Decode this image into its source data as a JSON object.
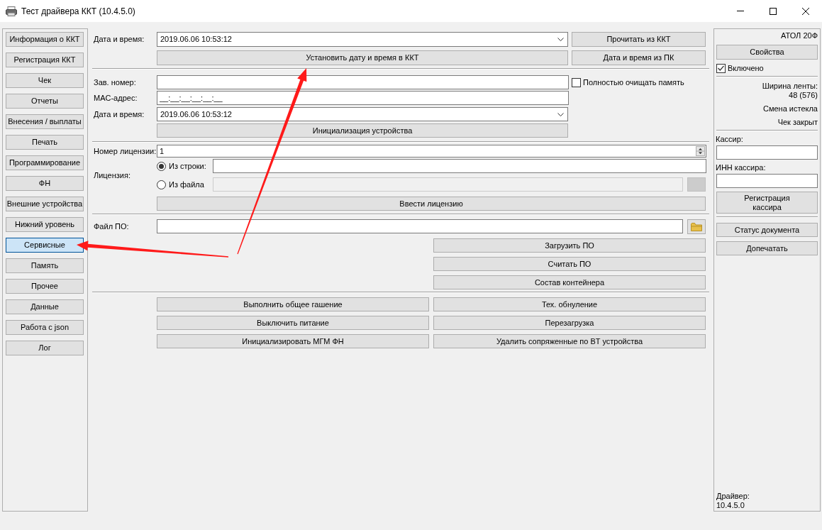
{
  "window": {
    "title": "Тест драйвера ККТ (10.4.5.0)"
  },
  "sidebar": {
    "items": [
      {
        "label": "Информация о ККТ",
        "selected": false
      },
      {
        "label": "Регистрация ККТ",
        "selected": false
      },
      {
        "label": "Чек",
        "selected": false
      },
      {
        "label": "Отчеты",
        "selected": false
      },
      {
        "label": "Внесения / выплаты",
        "selected": false
      },
      {
        "label": "Печать",
        "selected": false
      },
      {
        "label": "Программирование",
        "selected": false
      },
      {
        "label": "ФН",
        "selected": false
      },
      {
        "label": "Внешние устройства",
        "selected": false
      },
      {
        "label": "Нижний уровень",
        "selected": false
      },
      {
        "label": "Сервисные",
        "selected": true
      },
      {
        "label": "Память",
        "selected": false
      },
      {
        "label": "Прочее",
        "selected": false
      },
      {
        "label": "Данные",
        "selected": false
      },
      {
        "label": "Работа с json",
        "selected": false
      },
      {
        "label": "Лог",
        "selected": false
      }
    ]
  },
  "datetime": {
    "label": "Дата и время:",
    "value": "2019.06.06 10:53:12",
    "read_button": "Прочитать из ККТ",
    "set_button": "Установить дату и время в ККТ",
    "from_pc_button": "Дата и время из ПК"
  },
  "init": {
    "serial_label": "Зав. номер:",
    "clear_memory": {
      "label": "Полностью очищать память",
      "checked": false
    },
    "mac_label": "MAC-адрес:",
    "mac_value": "__:__:__:__:__:__",
    "datetime_label": "Дата и время:",
    "datetime_value": "2019.06.06 10:53:12",
    "button": "Инициализация устройства"
  },
  "license": {
    "number_label": "Номер лицензии:",
    "number_value": "1",
    "label": "Лицензия:",
    "sources": [
      {
        "kind": "text",
        "label": "Из строки:",
        "selected": true
      },
      {
        "kind": "file",
        "label": "Из файла",
        "selected": false
      }
    ],
    "button": "Ввести лицензию"
  },
  "firmware": {
    "label": "Файл ПО:",
    "buttons": [
      "Загрузить ПО",
      "Считать ПО",
      "Состав контейнера"
    ]
  },
  "service_buttons": [
    "Выполнить общее гашение",
    "Тех. обнуление",
    "Выключить питание",
    "Перезагрузка",
    "Инициализировать МГМ ФН",
    "Удалить сопряженные по BT устройства"
  ],
  "device_panel": {
    "model": "АТОЛ 20Ф",
    "properties_button": "Свойства",
    "enabled": {
      "label": "Включено",
      "checked": true
    },
    "tape_width_label": "Ширина ленты:",
    "tape_width_value": "48 (576)",
    "shift_status": "Смена истекла",
    "receipt_status": "Чек закрыт",
    "cashier_label": "Кассир:",
    "cashier_inn_label": "ИНН кассира:",
    "register_cashier_button": "Регистрация кассира",
    "buttons": [
      "Статус документа",
      "Допечатать"
    ],
    "driver_label": "Драйвер:",
    "driver_version": "10.4.5.0"
  }
}
